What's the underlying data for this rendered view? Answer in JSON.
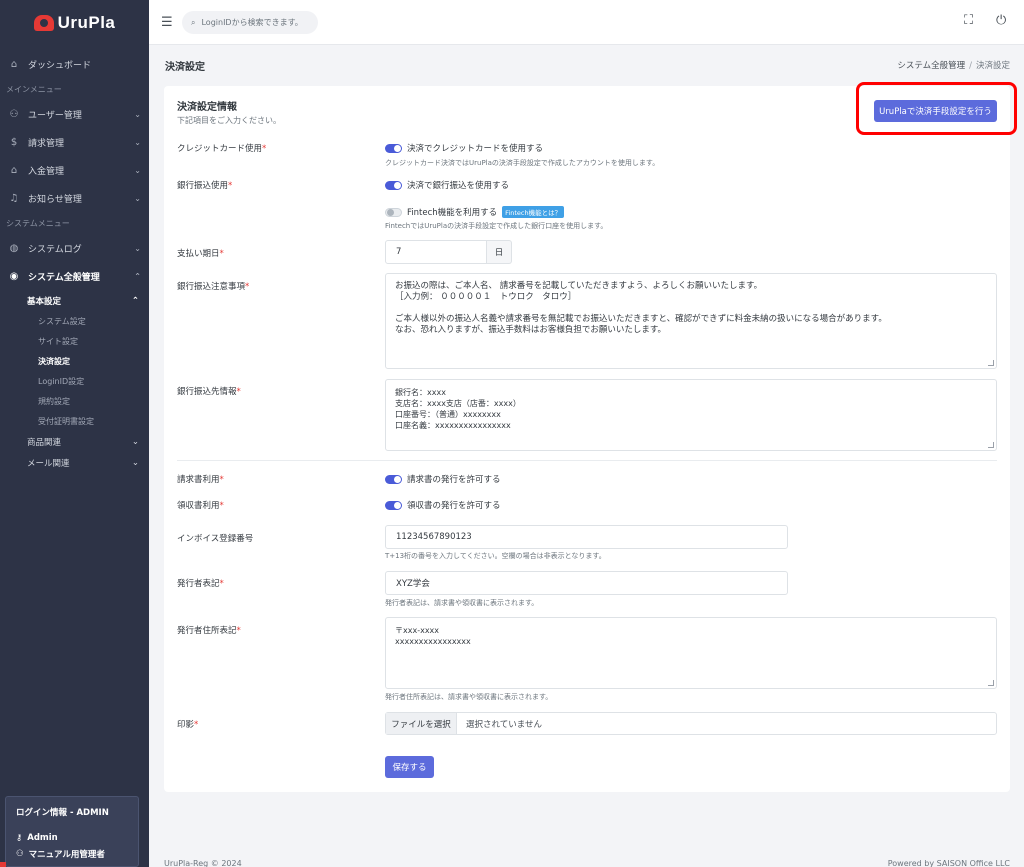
{
  "app": {
    "logo_text": "UruPla"
  },
  "sidebar": {
    "dashboard": "ダッシュボード",
    "main_menu_head": "メインメニュー",
    "main_items": [
      {
        "label": "ユーザー管理"
      },
      {
        "label": "請求管理"
      },
      {
        "label": "入金管理"
      },
      {
        "label": "お知らせ管理"
      }
    ],
    "system_menu_head": "システムメニュー",
    "system_log": "システムログ",
    "system_general": "システム全般管理",
    "basic_settings": "基本設定",
    "basic_sub": [
      "システム設定",
      "サイト設定",
      "決済設定",
      "LoginID設定",
      "規約設定",
      "受付証明書設定"
    ],
    "product": "商品関連",
    "mail": "メール関連"
  },
  "login": {
    "title": "ログイン情報 - ADMIN",
    "user": "Admin",
    "role": "マニュアル用管理者"
  },
  "header": {
    "search_placeholder": "LoginIDから検索できます。"
  },
  "page": {
    "title": "決済設定",
    "breadcrumb_parent": "システム全般管理",
    "breadcrumb_sep": "/",
    "breadcrumb_current": "決済設定"
  },
  "card": {
    "title": "決済設定情報",
    "subtitle": "下記項目をご入力ください。",
    "provider_button": "UruPlaで決済手段設定を行う"
  },
  "form": {
    "credit_label": "クレジットカード使用",
    "credit_toggle": "決済でクレジットカードを使用する",
    "credit_help": "クレジットカード決済ではUruPlaの決済手段設定で作成したアカウントを使用します。",
    "bank_label": "銀行振込使用",
    "bank_toggle": "決済で銀行振込を使用する",
    "fintech_toggle": "Fintech機能を利用する",
    "fintech_badge": "Fintech機能とは？",
    "fintech_help": "FintechではUruPlaの決済手段設定で作成した銀行口座を使用します。",
    "due_label": "支払い期日",
    "due_value": "7",
    "due_unit": "日",
    "bank_notice_label": "銀行振込注意事項",
    "bank_notice_lines": [
      "お振込の際は、ご本人名、 請求番号を記載していただきますよう、よろしくお願いいたします。",
      "［入力例： ０００００１　トウロク　タロウ］",
      "",
      "ご本人様以外の振込人名義や請求番号を無記載でお振込いただきますと、確認ができずに料金未納の扱いになる場合があります。",
      "なお、恐れ入りますが、振込手数料はお客様負担でお願いいたします。"
    ],
    "bank_info_label": "銀行振込先情報",
    "bank_info_lines": [
      "銀行名：xxxx",
      "支店名：xxxx支店（店番：xxxx）",
      "口座番号：（普通）xxxxxxxx",
      "口座名義：xxxxxxxxxxxxxxxx"
    ],
    "invoice_label": "請求書利用",
    "invoice_toggle": "請求書の発行を許可する",
    "receipt_label": "領収書利用",
    "receipt_toggle": "領収書の発行を許可する",
    "invoice_reg_label": "インボイス登録番号",
    "invoice_reg_value": "11234567890123",
    "invoice_reg_help": "T+13桁の番号を入力してください。空欄の場合は非表示となります。",
    "issuer_label": "発行者表記",
    "issuer_value": "XYZ学会",
    "issuer_help": "発行者表記は、請求書や領収書に表示されます。",
    "issuer_addr_label": "発行者住所表記",
    "issuer_addr_lines": [
      "〒xxx-xxxx",
      "xxxxxxxxxxxxxxxx"
    ],
    "issuer_addr_help": "発行者住所表記は、請求書や領収書に表示されます。",
    "seal_label": "印影",
    "file_button": "ファイルを選択",
    "file_none": "選択されていません",
    "save_button": "保存する",
    "required_mark": "*"
  },
  "footer": {
    "left": "UruPla-Reg © 2024",
    "right": "Powered by SAISON Office LLC"
  }
}
